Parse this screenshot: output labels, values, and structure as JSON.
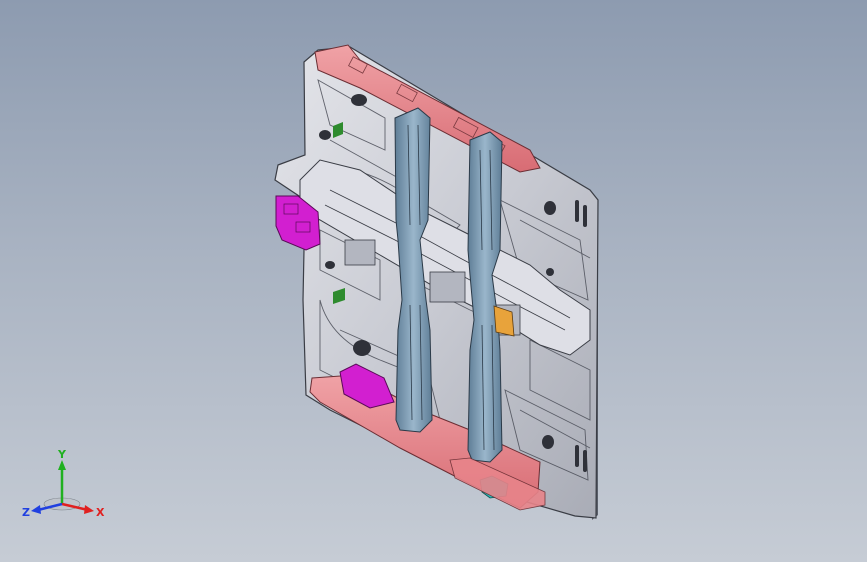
{
  "viewport": {
    "background_top": "#8d9bb0",
    "background_bottom": "#c6ccd5"
  },
  "model": {
    "panel_color": "#c9cbd3",
    "rail_color": "#7f9cb4",
    "flange_color": "#e8848a",
    "bracket_color": "#d21fd0",
    "accent_green": "#2e8b2e",
    "accent_cyan": "#29b8b8",
    "accent_orange": "#e8a33b"
  },
  "triad": {
    "x_label": "X",
    "y_label": "Y",
    "z_label": "Z",
    "x_color": "#e02020",
    "y_color": "#20b020",
    "z_color": "#2040e0"
  }
}
